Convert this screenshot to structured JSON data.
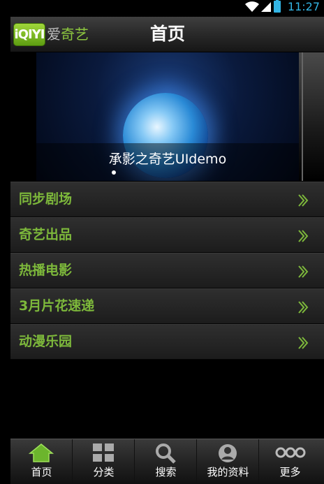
{
  "status_bar": {
    "time": "11:27"
  },
  "header": {
    "logo_badge": "iQIYI",
    "logo_word_1": "爱",
    "logo_word_2": "奇艺",
    "title": "首页"
  },
  "banner": {
    "caption": "承影之奇艺UIdemo"
  },
  "menu": [
    {
      "label": "同步剧场",
      "icon": "chevron-right-icon"
    },
    {
      "label": "奇艺出品",
      "icon": "chevron-right-icon"
    },
    {
      "label": "热播电影",
      "icon": "chevron-right-icon"
    },
    {
      "label": "3月片花速递",
      "icon": "chevron-right-icon"
    },
    {
      "label": "动漫乐园",
      "icon": "chevron-right-icon"
    }
  ],
  "tabs": [
    {
      "label": "首页",
      "icon": "home-icon"
    },
    {
      "label": "分类",
      "icon": "grid-icon"
    },
    {
      "label": "搜索",
      "icon": "search-icon"
    },
    {
      "label": "我的资料",
      "icon": "user-icon"
    },
    {
      "label": "更多",
      "icon": "more-icon"
    }
  ],
  "colors": {
    "accent": "#7db83b",
    "status": "#33b5e5"
  }
}
